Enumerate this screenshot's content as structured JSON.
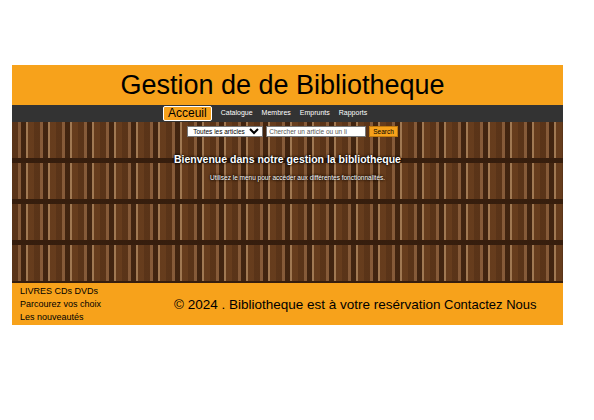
{
  "header": {
    "title": "Gestion de de Bibliotheque"
  },
  "nav": [
    {
      "label": "Acceuil",
      "selected": true
    },
    {
      "label": "Catalogue",
      "selected": false
    },
    {
      "label": "Membres",
      "selected": false
    },
    {
      "label": "Emprunts",
      "selected": false
    },
    {
      "label": "Rapports",
      "selected": false
    }
  ],
  "search": {
    "category": "Toutes les articles",
    "placeholder": "Chercher un article ou un li",
    "button": "Search"
  },
  "hero": {
    "title": "Bienvenue dans notre gestion la bibliotheque",
    "subtitle": "Utilisez le menu pour accéder aux différentes fonctionnalités."
  },
  "footer": {
    "links": [
      "LIVRES CDs DVDs",
      "Parcourez vos choix",
      "Les nouveautés"
    ],
    "copyright": "© 2024 . Bibliotheque est à votre resérvation",
    "contact": "Contactez Nous"
  }
}
